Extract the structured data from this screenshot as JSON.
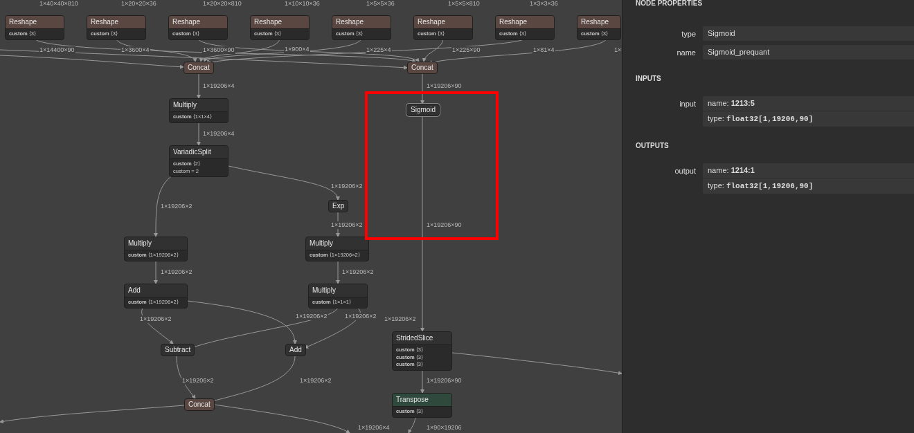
{
  "graph": {
    "nodes": [
      {
        "title": "Reshape",
        "kind": "shape",
        "selected": false,
        "attributes": [
          "**custom** ⟨3⟩"
        ]
      },
      {
        "title": "Reshape",
        "kind": "shape",
        "selected": false,
        "attributes": [
          "**custom** ⟨3⟩"
        ]
      },
      {
        "title": "Reshape",
        "kind": "shape",
        "selected": false,
        "attributes": [
          "**custom** ⟨3⟩"
        ]
      },
      {
        "title": "Reshape",
        "kind": "shape",
        "selected": false,
        "attributes": [
          "**custom** ⟨3⟩"
        ]
      },
      {
        "title": "Reshape",
        "kind": "shape",
        "selected": false,
        "attributes": [
          "**custom** ⟨3⟩"
        ]
      },
      {
        "title": "Reshape",
        "kind": "shape",
        "selected": false,
        "attributes": [
          "**custom** ⟨3⟩"
        ]
      },
      {
        "title": "Reshape",
        "kind": "shape",
        "selected": false,
        "attributes": [
          "**custom** ⟨3⟩"
        ]
      },
      {
        "title": "Reshape",
        "kind": "shape",
        "selected": false,
        "attributes": [
          "**custom** ⟨3⟩"
        ]
      },
      {
        "title": "Concat",
        "kind": "shape",
        "selected": false
      },
      {
        "title": "Concat",
        "kind": "shape",
        "selected": false
      },
      {
        "title": "Multiply",
        "kind": "op",
        "selected": false,
        "attributes": [
          "**custom** ⟨1×1×4⟩"
        ]
      },
      {
        "title": "Sigmoid",
        "kind": "op",
        "selected": true
      },
      {
        "title": "VariadicSplit",
        "kind": "op",
        "selected": false,
        "attributes": [
          "**custom** ⟨2⟩",
          "custom = 2"
        ]
      },
      {
        "title": "Exp",
        "kind": "op",
        "selected": false
      },
      {
        "title": "Multiply",
        "kind": "op",
        "selected": false,
        "attributes": [
          "**custom** ⟨1×19206×2⟩"
        ]
      },
      {
        "title": "Multiply",
        "kind": "op",
        "selected": false,
        "attributes": [
          "**custom** ⟨1×19206×2⟩"
        ]
      },
      {
        "title": "Add",
        "kind": "op",
        "selected": false,
        "attributes": [
          "**custom** ⟨1×19206×2⟩"
        ]
      },
      {
        "title": "Multiply",
        "kind": "op",
        "selected": false,
        "attributes": [
          "**custom** ⟨1×1×1⟩"
        ]
      },
      {
        "title": "Subtract",
        "kind": "op",
        "selected": false
      },
      {
        "title": "Add",
        "kind": "op",
        "selected": false
      },
      {
        "title": "StridedSlice",
        "kind": "op",
        "selected": false,
        "attributes": [
          "**custom** ⟨3⟩",
          "**custom** ⟨3⟩",
          "**custom** ⟨3⟩"
        ]
      },
      {
        "title": "Concat",
        "kind": "shape",
        "selected": false
      },
      {
        "title": "Transpose",
        "kind": "layout",
        "selected": false,
        "attributes": [
          "**custom** ⟨3⟩"
        ]
      }
    ],
    "edge_labels": [
      "1×40×40×810",
      "1×20×20×36",
      "1×20×20×810",
      "1×10×10×36",
      "1×5×5×36",
      "1×5×5×810",
      "1×3×3×36",
      "1×14400×90",
      "1×3600×4",
      "1×3600×90",
      "1×900×4",
      "1×225×4",
      "1×225×90",
      "1×81×4",
      "1×",
      "1×19206×4",
      "1×19206×90",
      "1×19206×4",
      "1×19206×2",
      "1×19206×2",
      "1×19206×2",
      "1×19206×90",
      "1×19206×2",
      "1×19206×2",
      "1×19206×2",
      "1×19206×2",
      "1×19206×2",
      "1×19206×2",
      "1×19206×2",
      "1×19206×2",
      "1×19206×90",
      "1×19206×4",
      "1×90×19206"
    ]
  },
  "properties": {
    "title": "NODE PROPERTIES",
    "fields": [
      {
        "label": "type",
        "value": "Sigmoid"
      },
      {
        "label": "name",
        "value": "Sigmoid_prequant"
      }
    ],
    "sections": [
      {
        "title": "INPUTS",
        "items": [
          {
            "label": "input",
            "lines": [
              {
                "kind": "name",
                "text": "name: **1213:5**"
              },
              {
                "kind": "type",
                "text": "type: **float32[1,19206,90]**"
              }
            ]
          }
        ]
      },
      {
        "title": "OUTPUTS",
        "items": [
          {
            "label": "output",
            "lines": [
              {
                "kind": "name",
                "text": "name: **1214:1**"
              },
              {
                "kind": "type",
                "text": "type: **float32[1,19206,90]**"
              }
            ]
          }
        ]
      }
    ]
  }
}
